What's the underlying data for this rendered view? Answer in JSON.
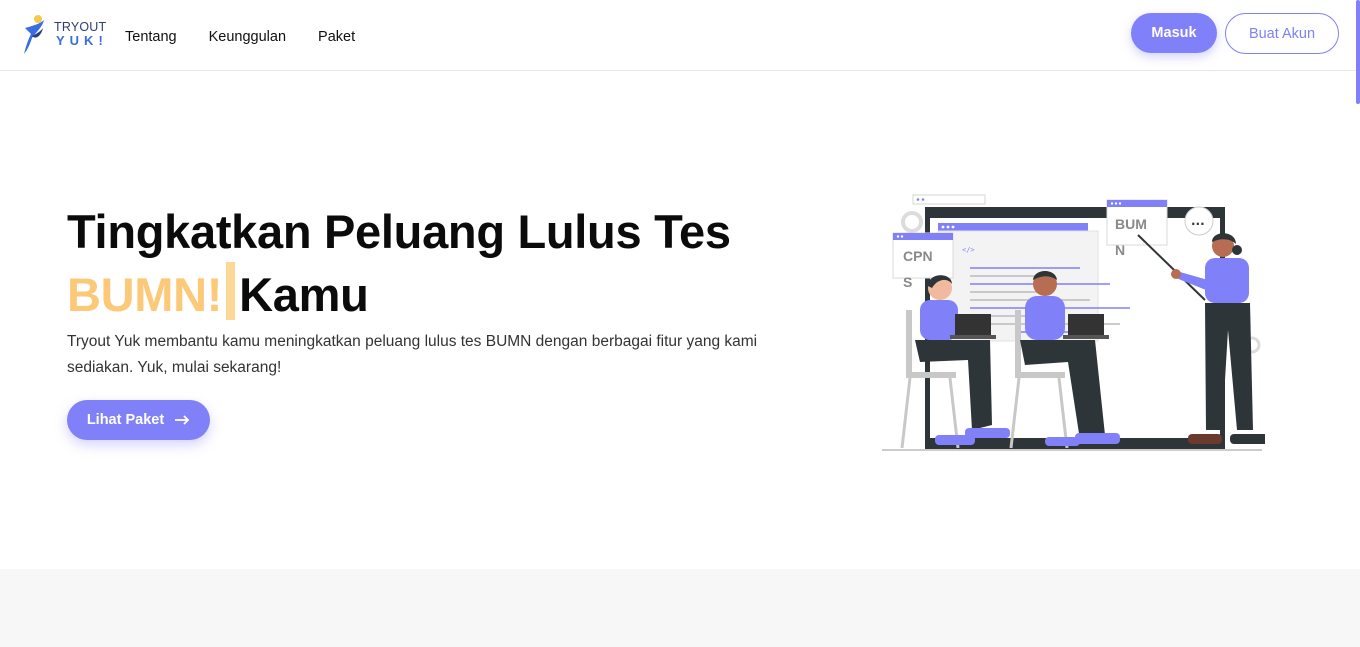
{
  "brand": {
    "line1": "TRYOUT",
    "line2": "YUK!"
  },
  "nav": {
    "items": [
      "Tentang",
      "Keunggulan",
      "Paket"
    ]
  },
  "auth": {
    "login_label": "Masuk",
    "register_label": "Buat Akun"
  },
  "hero": {
    "title_line1": "Tingkatkan Peluang Lulus Tes",
    "title_accent": "BUMN!",
    "title_tail": "Kamu",
    "description": "Tryout Yuk membantu kamu meningkatkan peluang lulus tes BUMN dengan berbagai fitur yang kami sediakan. Yuk, mulai sekarang!",
    "cta_label": "Lihat Paket",
    "cta_icon": "arrow-right-icon"
  },
  "illustration": {
    "card_left_label_line1": "CPN",
    "card_left_label_line2": "S",
    "card_right_label_line1": "BUM",
    "card_right_label_line2": "N",
    "code_tag": "</>",
    "speech": "..."
  },
  "colors": {
    "accent": "#8080f8",
    "highlight": "#fcc978",
    "brand_dark": "#2f3a78",
    "brand_blue": "#3a6de0"
  }
}
